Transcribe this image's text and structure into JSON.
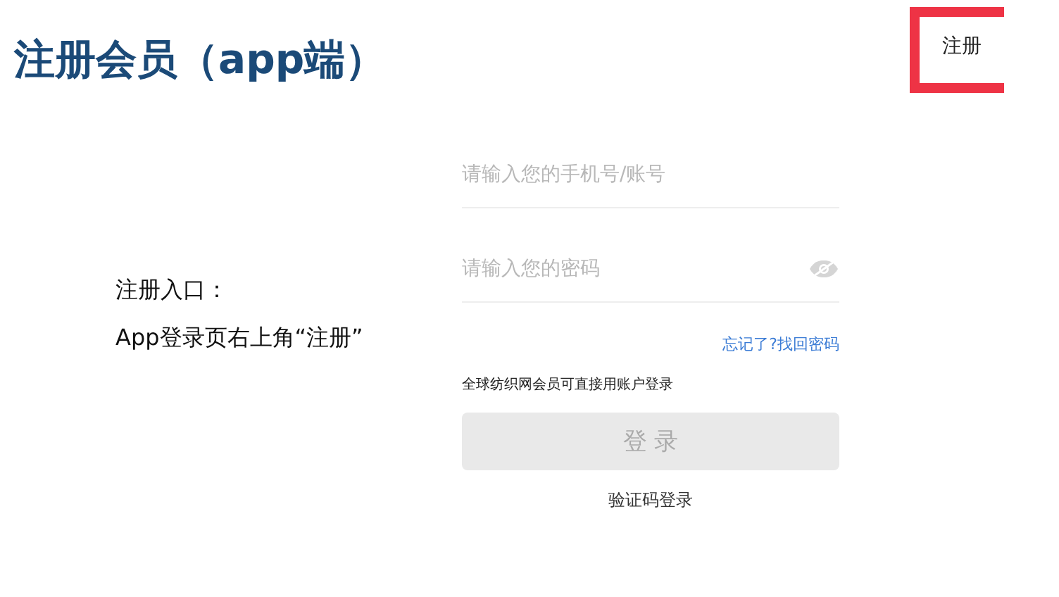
{
  "title": "注册会员（app端）",
  "register_link": {
    "label": "注册",
    "highlighted": true
  },
  "note": [
    "注册入口：",
    "App登录页右上角“注册”"
  ],
  "form": {
    "account_field": {
      "placeholder": "请输入您的手机号/账号"
    },
    "password_field": {
      "placeholder": "请输入您的密码"
    },
    "forgot_link": "忘记了?找回密码",
    "hint": "全球纺织网会员可直接用账户登录",
    "login_button": {
      "label": "登 录",
      "disabled": true
    },
    "sms_login_link": "验证码登录"
  }
}
